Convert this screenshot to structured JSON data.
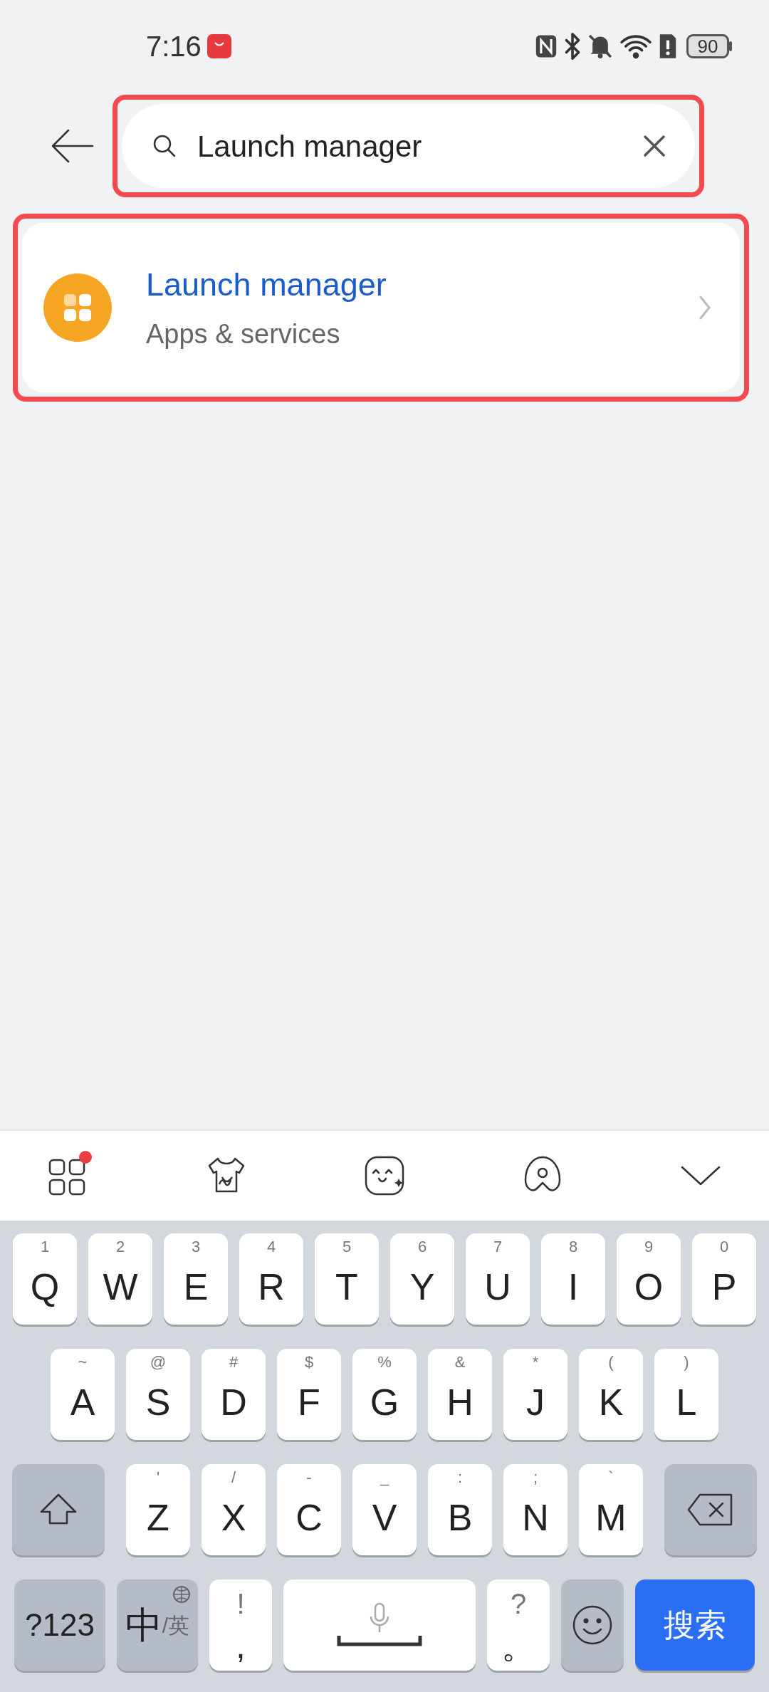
{
  "status_bar": {
    "time": "7:16",
    "battery": "90"
  },
  "search": {
    "value": "Launch manager",
    "highlighted": true
  },
  "results": [
    {
      "title": "Launch manager",
      "subtitle": "Apps & services",
      "highlighted": true
    }
  ],
  "keyboard": {
    "rows": [
      [
        {
          "kind": "letter",
          "label": "Q",
          "hint": "1"
        },
        {
          "kind": "letter",
          "label": "W",
          "hint": "2"
        },
        {
          "kind": "letter",
          "label": "E",
          "hint": "3"
        },
        {
          "kind": "letter",
          "label": "R",
          "hint": "4"
        },
        {
          "kind": "letter",
          "label": "T",
          "hint": "5"
        },
        {
          "kind": "letter",
          "label": "Y",
          "hint": "6"
        },
        {
          "kind": "letter",
          "label": "U",
          "hint": "7"
        },
        {
          "kind": "letter",
          "label": "I",
          "hint": "8"
        },
        {
          "kind": "letter",
          "label": "O",
          "hint": "9"
        },
        {
          "kind": "letter",
          "label": "P",
          "hint": "0"
        }
      ],
      [
        {
          "kind": "letter",
          "label": "A",
          "hint": "~"
        },
        {
          "kind": "letter",
          "label": "S",
          "hint": "@"
        },
        {
          "kind": "letter",
          "label": "D",
          "hint": "#"
        },
        {
          "kind": "letter",
          "label": "F",
          "hint": "$"
        },
        {
          "kind": "letter",
          "label": "G",
          "hint": "%"
        },
        {
          "kind": "letter",
          "label": "H",
          "hint": "&"
        },
        {
          "kind": "letter",
          "label": "J",
          "hint": "*"
        },
        {
          "kind": "letter",
          "label": "K",
          "hint": "("
        },
        {
          "kind": "letter",
          "label": "L",
          "hint": ")"
        }
      ],
      [
        {
          "kind": "shift"
        },
        {
          "kind": "letter",
          "label": "Z",
          "hint": "'"
        },
        {
          "kind": "letter",
          "label": "X",
          "hint": "/"
        },
        {
          "kind": "letter",
          "label": "C",
          "hint": "-"
        },
        {
          "kind": "letter",
          "label": "V",
          "hint": "_"
        },
        {
          "kind": "letter",
          "label": "B",
          "hint": ":"
        },
        {
          "kind": "letter",
          "label": "N",
          "hint": ";"
        },
        {
          "kind": "letter",
          "label": "M",
          "hint": "`"
        },
        {
          "kind": "backspace"
        }
      ],
      [
        {
          "kind": "symbols",
          "label": "?123"
        },
        {
          "kind": "lang",
          "label": "中",
          "sub": "/英"
        },
        {
          "kind": "punct",
          "label": ",",
          "hint": "!"
        },
        {
          "kind": "space"
        },
        {
          "kind": "punct",
          "label": "。",
          "hint": "?"
        },
        {
          "kind": "emoji"
        },
        {
          "kind": "action",
          "label": "搜索"
        }
      ]
    ]
  }
}
